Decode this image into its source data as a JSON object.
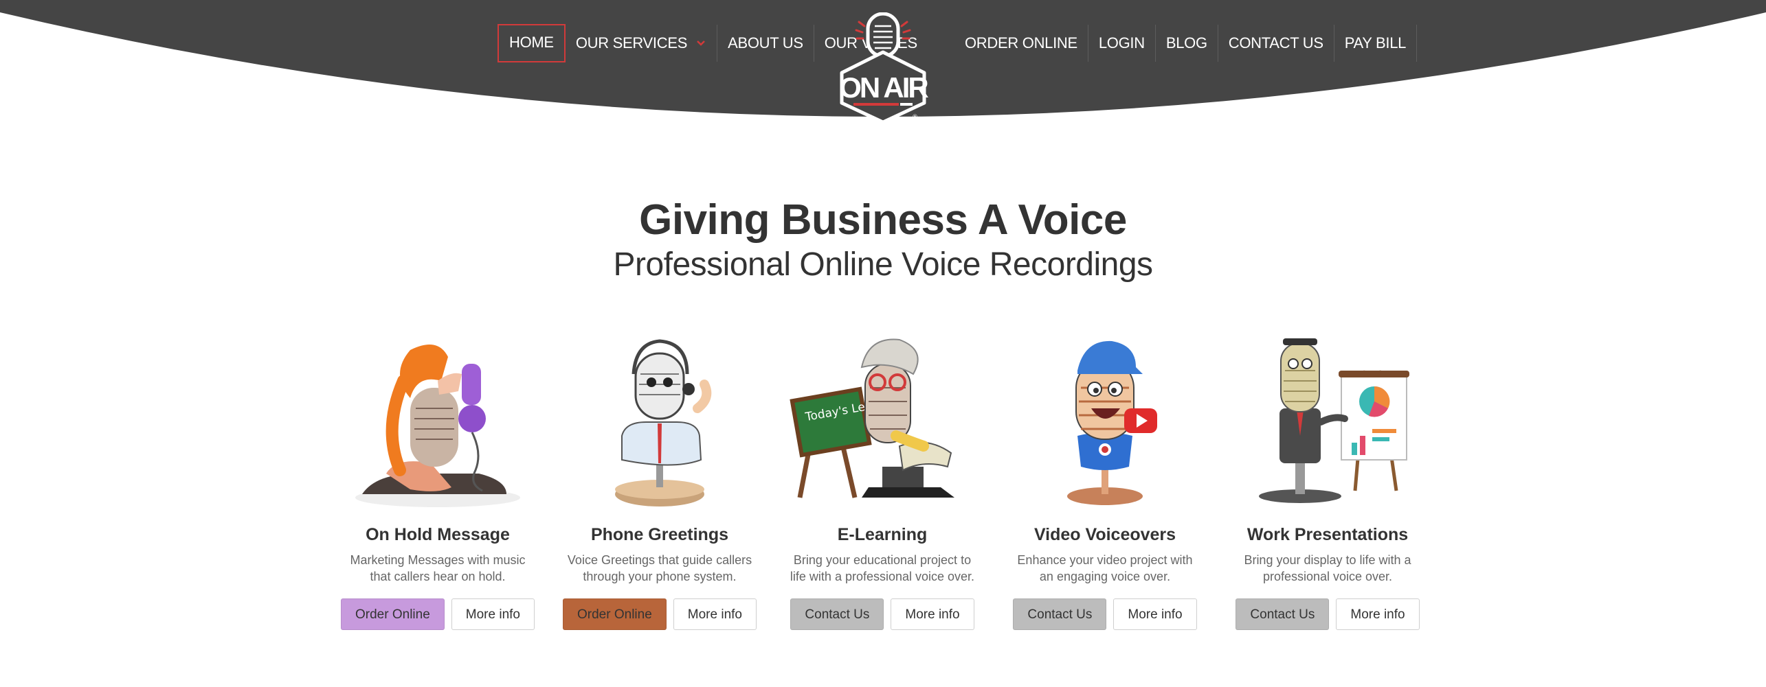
{
  "nav": {
    "left": [
      {
        "label": "HOME",
        "active": true
      },
      {
        "label": "OUR SERVICES",
        "dropdown": true
      },
      {
        "label": "ABOUT US"
      },
      {
        "label": "OUR VOICES"
      }
    ],
    "right": [
      {
        "label": "ORDER ONLINE"
      },
      {
        "label": "LOGIN"
      },
      {
        "label": "BLOG"
      },
      {
        "label": "CONTACT US"
      },
      {
        "label": "PAY BILL"
      }
    ]
  },
  "logo": {
    "text": "ON AIR",
    "icon": "microphone-icon"
  },
  "hero": {
    "title": "Giving Business A Voice",
    "subtitle": "Professional Online Voice Recordings"
  },
  "colors": {
    "header": "#454545",
    "accent_red": "#d23a3a",
    "purple": "#c79add",
    "copper": "#b8653a",
    "gray": "#bcbcbc"
  },
  "services": [
    {
      "title": "On Hold Message",
      "description": "Marketing Messages with music that callers hear on hold.",
      "primary_label": "Order Online",
      "primary_color": "#c79add",
      "secondary_label": "More info",
      "illustration": "woman-on-phone-microphone"
    },
    {
      "title": "Phone Greetings",
      "description": "Voice Greetings that guide callers through your phone system.",
      "primary_label": "Order Online",
      "primary_color": "#b8653a",
      "secondary_label": "More info",
      "illustration": "headset-microphone-character"
    },
    {
      "title": "E-Learning",
      "description": "Bring your educational project to life with a professional voice over.",
      "primary_label": "Contact Us",
      "primary_color": "#bcbcbc",
      "secondary_label": "More info",
      "illustration": "teacher-microphone-chalkboard",
      "chalkboard_text": "Today's Lesson"
    },
    {
      "title": "Video Voiceovers",
      "description": "Enhance your video project with an engaging voice over.",
      "primary_label": "Contact Us",
      "primary_color": "#bcbcbc",
      "secondary_label": "More info",
      "illustration": "microphone-with-video-play-button"
    },
    {
      "title": "Work Presentations",
      "description": "Bring your display to life with a professional voice over.",
      "primary_label": "Contact Us",
      "primary_color": "#bcbcbc",
      "secondary_label": "More info",
      "illustration": "businessman-microphone-presentation"
    }
  ]
}
